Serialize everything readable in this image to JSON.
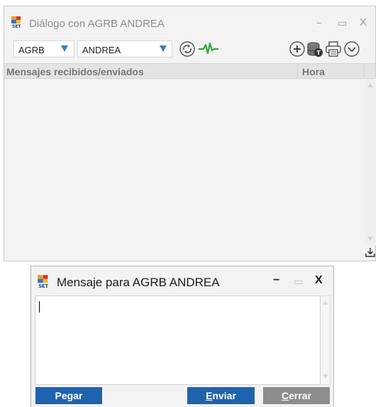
{
  "main_window": {
    "title": "Diálogo con AGRB ANDREA",
    "controls": {
      "minimize": "−",
      "maximize": "▭",
      "close": "X"
    },
    "toolbar": {
      "company_combo": "AGRB",
      "user_combo": "ANDREA",
      "icons": [
        "refresh-icon",
        "activity-icon",
        "add-icon",
        "database-icon",
        "print-icon",
        "chevron-down-icon"
      ]
    },
    "columns": {
      "messages": "Mensajes recibidos/enviados",
      "time": "Hora"
    }
  },
  "message_window": {
    "title": "Mensaje para AGRB ANDREA",
    "controls": {
      "minimize": "−",
      "maximize": "▭",
      "close": "X"
    },
    "input_value": "",
    "buttons": {
      "paste": "Pegar",
      "send_mnemonic": "E",
      "send_rest": "nviar",
      "close_mnemonic": "C",
      "close_rest": "errar"
    }
  },
  "colors": {
    "accent_blue": "#1e63ad",
    "button_gray": "#8d8d8d",
    "activity_green": "#2fa83a",
    "combo_arrow": "#3a7fb0"
  }
}
